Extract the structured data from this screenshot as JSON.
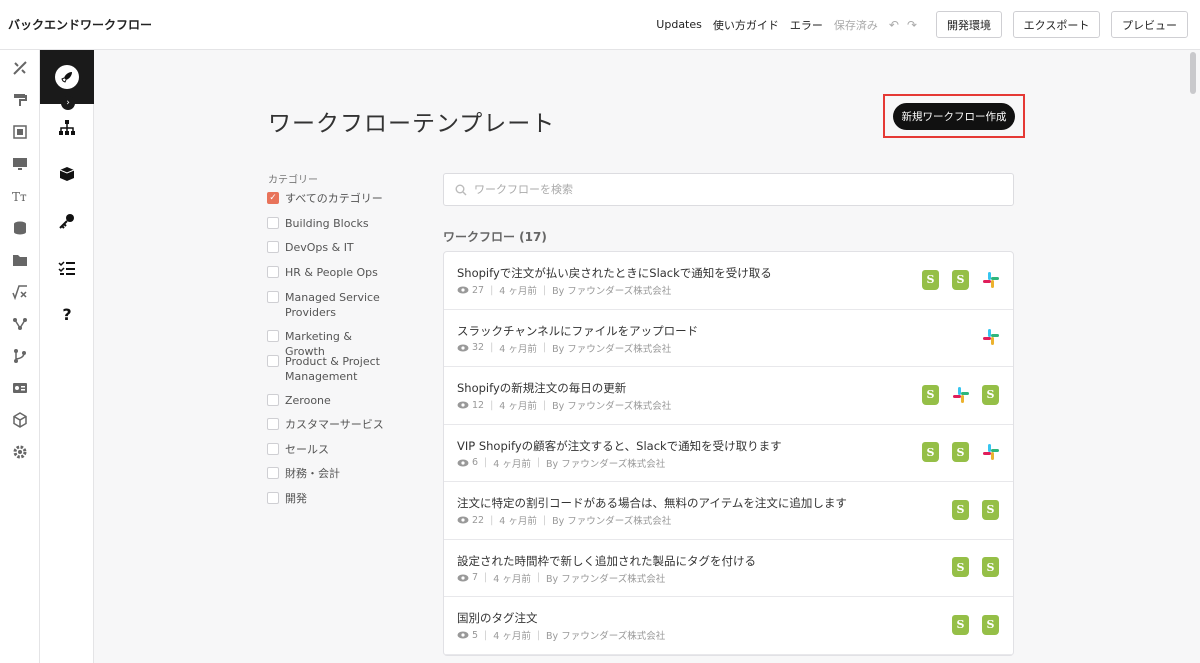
{
  "app": {
    "title": "バックエンドワークフロー"
  },
  "topbar": {
    "updates": "Updates",
    "guide": "使い方ガイド",
    "errors": "エラー",
    "saved": "保存済み",
    "env_button": "開発環境",
    "export_button": "エクスポート",
    "preview_button": "プレビュー"
  },
  "page": {
    "title": "ワークフローテンプレート",
    "new_button": "新規ワークフロー作成"
  },
  "categories": {
    "label": "カテゴリー",
    "items": [
      {
        "label": "すべてのカテゴリー",
        "checked": true
      },
      {
        "label": "Building Blocks",
        "checked": false
      },
      {
        "label": "DevOps & IT",
        "checked": false
      },
      {
        "label": "HR & People Ops",
        "checked": false
      },
      {
        "label": "Managed Service Providers",
        "checked": false
      },
      {
        "label": "Marketing & Growth",
        "checked": false
      },
      {
        "label": "Product & Project Management",
        "checked": false
      },
      {
        "label": "Zeroone",
        "checked": false
      },
      {
        "label": "カスタマーサービス",
        "checked": false
      },
      {
        "label": "セールス",
        "checked": false
      },
      {
        "label": "財務・会計",
        "checked": false
      },
      {
        "label": "開発",
        "checked": false
      }
    ]
  },
  "search": {
    "placeholder": "ワークフローを検索"
  },
  "workflows": {
    "heading": "ワークフロー (17)",
    "items": [
      {
        "title": "Shopifyで注文が払い戻されたときにSlackで通知を受け取る",
        "views": "27",
        "age": "4 ヶ月前",
        "author": "By ファウンダーズ株式会社",
        "icons": [
          "shopify",
          "shopify",
          "slack"
        ]
      },
      {
        "title": "スラックチャンネルにファイルをアップロード",
        "views": "32",
        "age": "4 ヶ月前",
        "author": "By ファウンダーズ株式会社",
        "icons": [
          "slack"
        ]
      },
      {
        "title": "Shopifyの新規注文の毎日の更新",
        "views": "12",
        "age": "4 ヶ月前",
        "author": "By ファウンダーズ株式会社",
        "icons": [
          "shopify",
          "slack",
          "shopify"
        ]
      },
      {
        "title": "VIP Shopifyの顧客が注文すると、Slackで通知を受け取ります",
        "views": "6",
        "age": "4 ヶ月前",
        "author": "By ファウンダーズ株式会社",
        "icons": [
          "shopify",
          "shopify",
          "slack"
        ]
      },
      {
        "title": "注文に特定の割引コードがある場合は、無料のアイテムを注文に追加します",
        "views": "22",
        "age": "4 ヶ月前",
        "author": "By ファウンダーズ株式会社",
        "icons": [
          "shopify",
          "shopify"
        ]
      },
      {
        "title": "設定された時間枠で新しく追加された製品にタグを付ける",
        "views": "7",
        "age": "4 ヶ月前",
        "author": "By ファウンダーズ株式会社",
        "icons": [
          "shopify",
          "shopify"
        ]
      },
      {
        "title": "国別のタグ注文",
        "views": "5",
        "age": "4 ヶ月前",
        "author": "By ファウンダーズ株式会社",
        "icons": [
          "shopify",
          "shopify"
        ]
      }
    ]
  },
  "colors": {
    "accent": "#e8735a",
    "shopify": "#95bf47",
    "highlight": "#e53935"
  }
}
